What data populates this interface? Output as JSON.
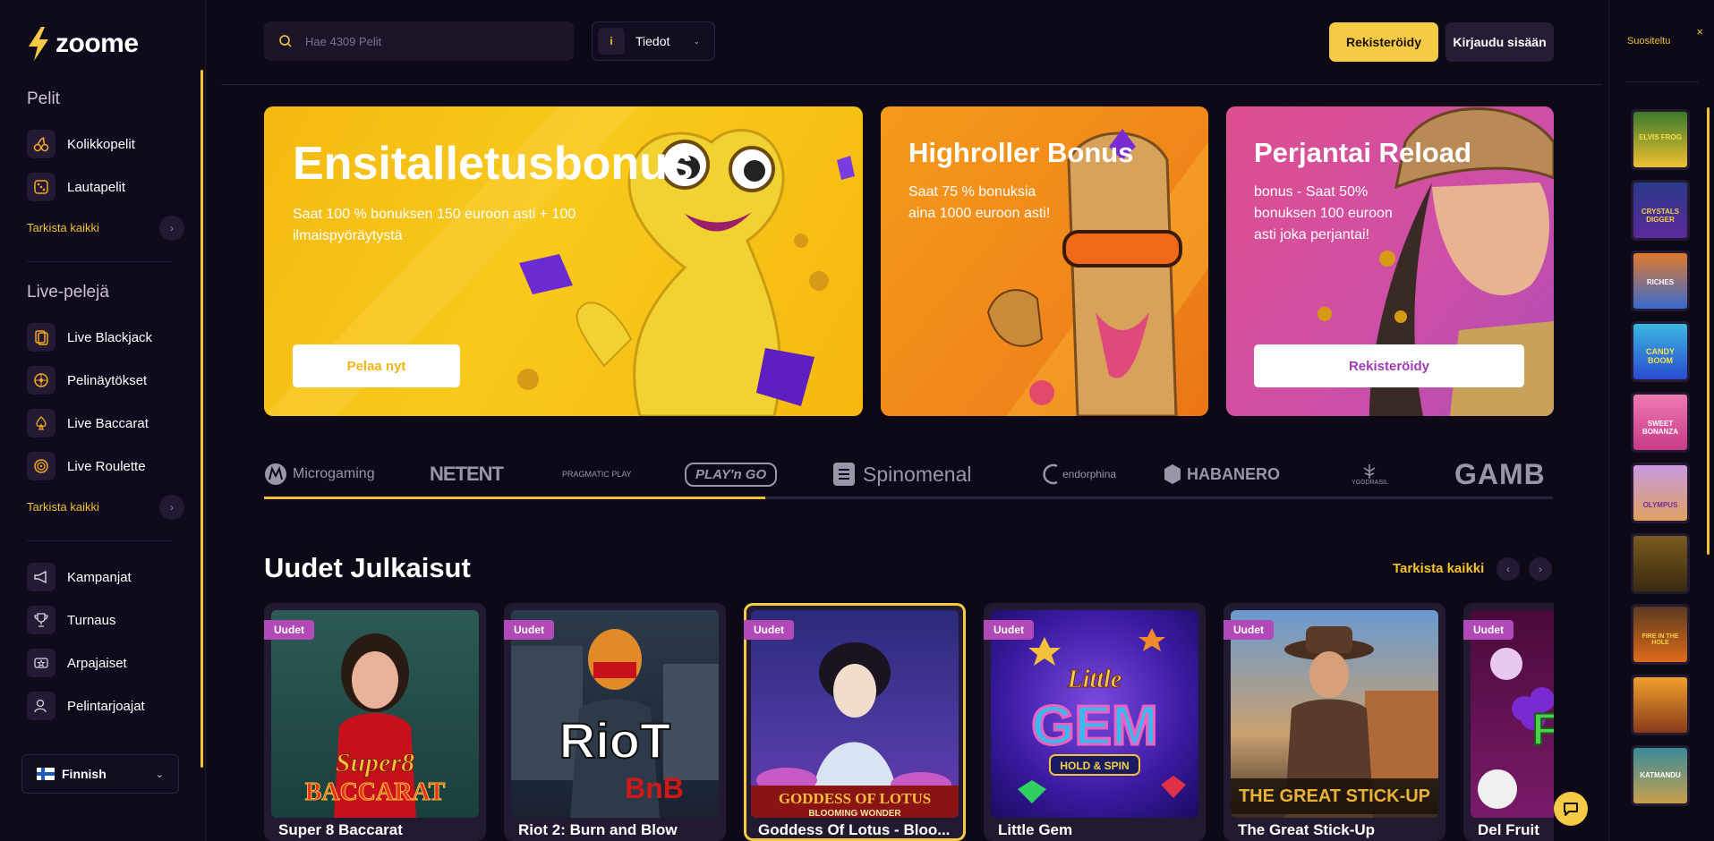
{
  "brand": {
    "name": "zoome"
  },
  "header": {
    "search_placeholder": "Hae 4309 Pelit",
    "info_label": "Tiedot",
    "info_icon": "i",
    "register_label": "Rekisteröidy",
    "login_label": "Kirjaudu sisään"
  },
  "sidebar": {
    "games_title": "Pelit",
    "games_items": [
      {
        "label": "Kolikkopelit",
        "icon": "cherry-icon"
      },
      {
        "label": "Lautapelit",
        "icon": "dice-icon"
      }
    ],
    "games_see_all": "Tarkista kaikki",
    "live_title": "Live-pelejä",
    "live_items": [
      {
        "label": "Live Blackjack",
        "icon": "cards-icon"
      },
      {
        "label": "Pelinäytökset",
        "icon": "wheel-icon"
      },
      {
        "label": "Live Baccarat",
        "icon": "spade-icon"
      },
      {
        "label": "Live Roulette",
        "icon": "roulette-icon"
      }
    ],
    "live_see_all": "Tarkista kaikki",
    "extra_items": [
      {
        "label": "Kampanjat",
        "icon": "megaphone-icon"
      },
      {
        "label": "Turnaus",
        "icon": "trophy-icon"
      },
      {
        "label": "Arpajaiset",
        "icon": "ticket-icon"
      },
      {
        "label": "Pelintarjoajat",
        "icon": "provider-icon"
      }
    ],
    "language": "Finnish"
  },
  "banners": [
    {
      "title": "Ensitalletusbonus",
      "text_line1": "Saat 100 % bonuksen 150 euroon asti + 100",
      "text_line2": "ilmaispyöräytystä",
      "button": "Pelaa nyt"
    },
    {
      "title": "Highroller Bonus",
      "text_line1": "Saat 75 % bonuksia",
      "text_line2": "aina 1000 euroon asti!"
    },
    {
      "title": "Perjantai Reload",
      "text_line1": "bonus - Saat 50%",
      "text_line2": "bonuksen 100 euroon",
      "text_line3": "asti joka perjantai!",
      "button": "Rekisteröidy"
    }
  ],
  "providers": [
    "Microgaming",
    "NETENT",
    "PRAGMATIC PLAY",
    "PLAY'n GO",
    "Spinomenal",
    "endorphina",
    "HABANERO",
    "YGGDRASIL",
    "GAMB"
  ],
  "new_releases": {
    "title": "Uudet Julkaisut",
    "see_all": "Tarkista kaikki",
    "badge": "Uudet",
    "games": [
      {
        "title": "Super 8 Baccarat",
        "art_text": "Super8 BACCARAT"
      },
      {
        "title": "Riot 2: Burn and Blow",
        "art_text": "RioT BnB"
      },
      {
        "title": "Goddess Of Lotus - Bloo...",
        "art_text": "GODDESS OF LOTUS"
      },
      {
        "title": "Little Gem",
        "art_text": "Little GEM"
      },
      {
        "title": "The Great Stick-Up",
        "art_text": "THE GREAT STICK-UP"
      },
      {
        "title": "Del Fruit",
        "art_text": "FRU"
      }
    ]
  },
  "rail": {
    "title": "Suositeltu",
    "close_icon": "×",
    "thumbs": [
      "ELVIS FROG",
      "CRYSTALS DIGGER",
      "RICHES",
      "CANDY BOOM",
      "SWEET BONANZA",
      "OLYMPUS",
      "",
      "FIRE IN THE HOLE",
      "",
      "KATMANDU"
    ]
  },
  "colors": {
    "accent": "#f5cb46",
    "background": "#0d0917",
    "badge": "#b14ab7"
  }
}
